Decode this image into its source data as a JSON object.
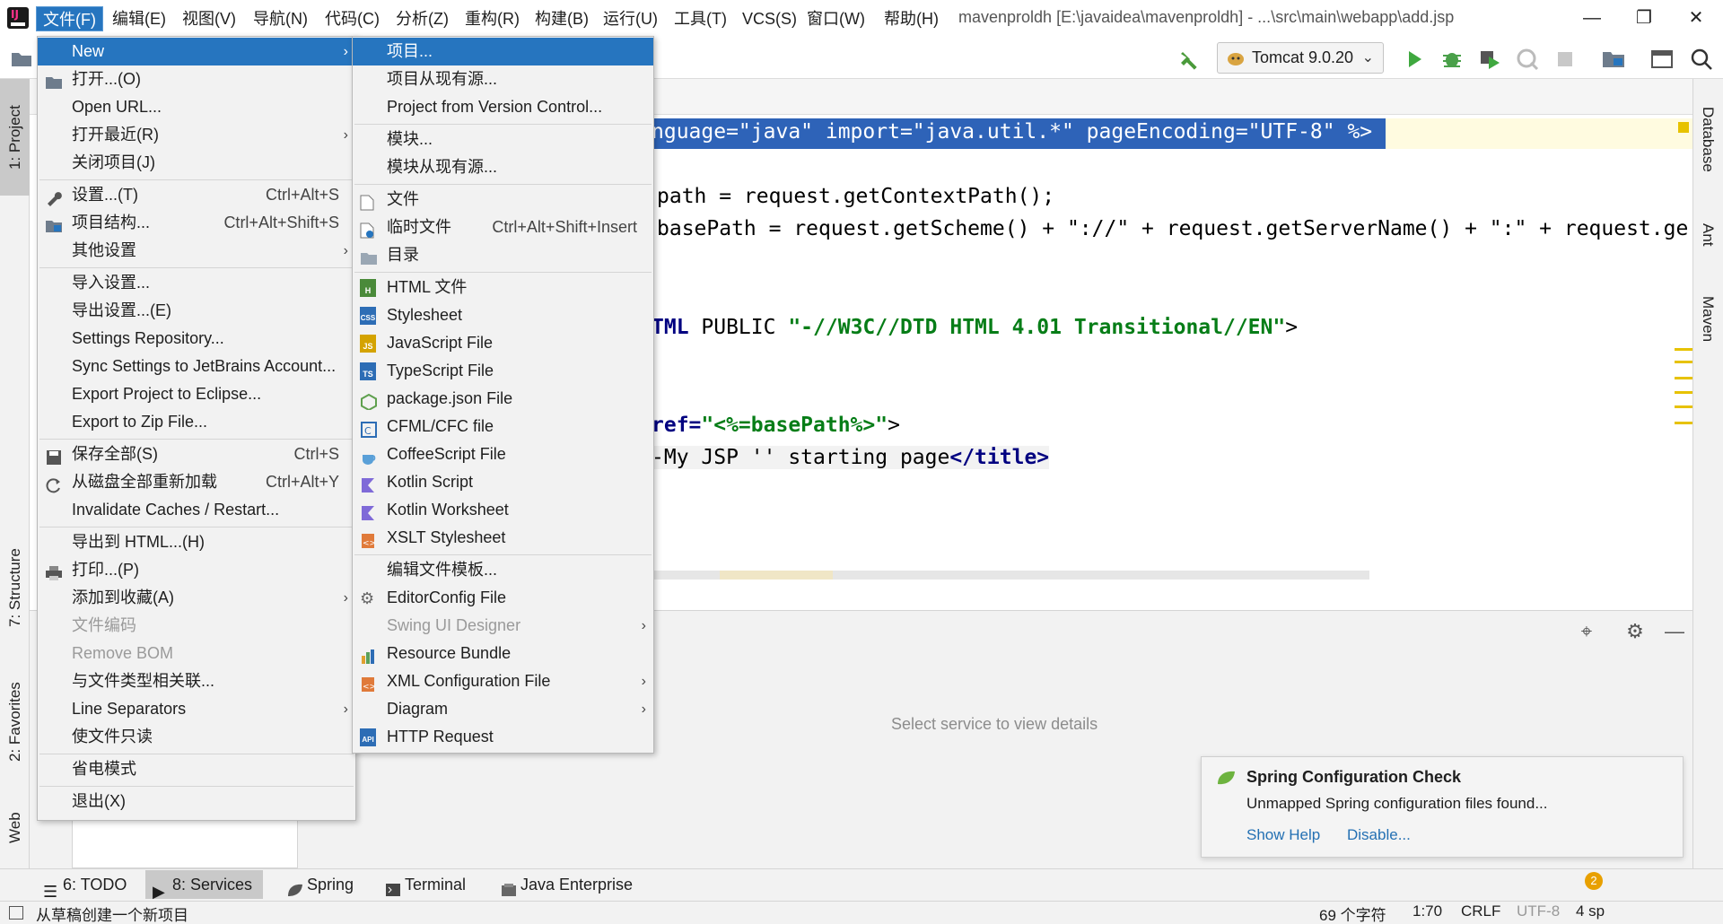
{
  "menubar": {
    "items": [
      "文件(F)",
      "编辑(E)",
      "视图(V)",
      "导航(N)",
      "代码(C)",
      "分析(Z)",
      "重构(R)",
      "构建(B)",
      "运行(U)",
      "工具(T)",
      "VCS(S)",
      "窗口(W)",
      "帮助(H)"
    ],
    "window_title": "mavenproldh [E:\\javaidea\\mavenproldh] - ...\\src\\main\\webapp\\add.jsp"
  },
  "toolbar": {
    "run_config": "Tomcat 9.0.20"
  },
  "left_tabs": {
    "project": "1: Project",
    "structure": "7: Structure",
    "favorites": "2: Favorites",
    "web": "Web"
  },
  "right_tabs": {
    "database": "Database",
    "ant": "Ant",
    "maven": "Maven"
  },
  "editor": {
    "line1_a": "nguage=\"java\" import=\"java.util.*\" pageEncoding=\"UTF-8\" %>",
    "line2": "path = request.getContextPath();",
    "line3": "basePath = request.getScheme() + \"://\" + request.getServerName() + \":\" + request.ge",
    "line4_kw": "TML",
    "line4_rest": " PUBLIC ",
    "line4_str": "\"-//W3C//DTD HTML 4.01 Transitional//EN\"",
    "line4_end": ">",
    "line5_kw": "ref=",
    "line5_str": "\"<%=basePath%>\"",
    "line5_end": ">",
    "line6_a": "My JSP '' starting page",
    "line6_kw": "</title>",
    "line6_prefix": "-"
  },
  "file_menu": {
    "items": [
      {
        "label": "New",
        "shortcut": "",
        "submenu": true
      },
      {
        "label": "打开...(O)",
        "shortcut": ""
      },
      {
        "label": "Open URL...",
        "shortcut": ""
      },
      {
        "label": "打开最近(R)",
        "shortcut": "",
        "submenu": true
      },
      {
        "label": "关闭项目(J)",
        "shortcut": ""
      },
      {
        "label": "设置...(T)",
        "shortcut": "Ctrl+Alt+S"
      },
      {
        "label": "项目结构...",
        "shortcut": "Ctrl+Alt+Shift+S"
      },
      {
        "label": "其他设置",
        "shortcut": "",
        "submenu": true
      },
      {
        "label": "导入设置...",
        "shortcut": ""
      },
      {
        "label": "导出设置...(E)",
        "shortcut": ""
      },
      {
        "label": "Settings Repository...",
        "shortcut": ""
      },
      {
        "label": "Sync Settings to JetBrains Account...",
        "shortcut": ""
      },
      {
        "label": "Export Project to Eclipse...",
        "shortcut": ""
      },
      {
        "label": "Export to Zip File...",
        "shortcut": ""
      },
      {
        "label": "保存全部(S)",
        "shortcut": "Ctrl+S"
      },
      {
        "label": "从磁盘全部重新加载",
        "shortcut": "Ctrl+Alt+Y"
      },
      {
        "label": "Invalidate Caches / Restart...",
        "shortcut": ""
      },
      {
        "label": "导出到 HTML...(H)",
        "shortcut": ""
      },
      {
        "label": "打印...(P)",
        "shortcut": ""
      },
      {
        "label": "添加到收藏(A)",
        "shortcut": "",
        "submenu": true
      },
      {
        "label": "文件编码",
        "shortcut": "",
        "disabled": true
      },
      {
        "label": "Remove BOM",
        "shortcut": "",
        "disabled": true
      },
      {
        "label": "与文件类型相关联...",
        "shortcut": ""
      },
      {
        "label": "Line Separators",
        "shortcut": "",
        "submenu": true
      },
      {
        "label": "使文件只读",
        "shortcut": ""
      },
      {
        "label": "省电模式",
        "shortcut": ""
      },
      {
        "label": "退出(X)",
        "shortcut": ""
      }
    ]
  },
  "new_submenu": {
    "items": [
      {
        "label": "项目...",
        "shortcut": ""
      },
      {
        "label": "项目从现有源...",
        "shortcut": ""
      },
      {
        "label": "Project from Version Control...",
        "shortcut": ""
      },
      {
        "label": "模块...",
        "shortcut": ""
      },
      {
        "label": "模块从现有源...",
        "shortcut": ""
      },
      {
        "label": "文件",
        "shortcut": ""
      },
      {
        "label": "临时文件",
        "shortcut": "Ctrl+Alt+Shift+Insert"
      },
      {
        "label": "目录",
        "shortcut": ""
      },
      {
        "label": "HTML 文件",
        "shortcut": ""
      },
      {
        "label": "Stylesheet",
        "shortcut": ""
      },
      {
        "label": "JavaScript File",
        "shortcut": ""
      },
      {
        "label": "TypeScript File",
        "shortcut": ""
      },
      {
        "label": "package.json File",
        "shortcut": ""
      },
      {
        "label": "CFML/CFC file",
        "shortcut": ""
      },
      {
        "label": "CoffeeScript File",
        "shortcut": ""
      },
      {
        "label": "Kotlin Script",
        "shortcut": ""
      },
      {
        "label": "Kotlin Worksheet",
        "shortcut": ""
      },
      {
        "label": "XSLT Stylesheet",
        "shortcut": ""
      },
      {
        "label": "编辑文件模板...",
        "shortcut": ""
      },
      {
        "label": "EditorConfig File",
        "shortcut": ""
      },
      {
        "label": "Swing UI Designer",
        "shortcut": "",
        "disabled": true,
        "submenu": true
      },
      {
        "label": "Resource Bundle",
        "shortcut": ""
      },
      {
        "label": "XML Configuration File",
        "shortcut": "",
        "submenu": true
      },
      {
        "label": "Diagram",
        "shortcut": "",
        "submenu": true
      },
      {
        "label": "HTTP Request",
        "shortcut": ""
      }
    ],
    "icon_badges": {
      "html": "H",
      "css": "CSS",
      "js": "JS",
      "ts": "TS",
      "api": "API"
    }
  },
  "services": {
    "hint": "Select service to view details"
  },
  "notification": {
    "title": "Spring Configuration Check",
    "body": "Unmapped Spring configuration files found...",
    "show_help": "Show Help",
    "disable": "Disable...",
    "badge_count": "2"
  },
  "bottom_tabs": {
    "todo": "6: TODO",
    "services": "8: Services",
    "spring": "Spring",
    "terminal": "Terminal",
    "java_enterprise": "Java Enterprise"
  },
  "status": {
    "text": "从草稿创建一个新项目",
    "chars": "69 个字符",
    "position": "1:70",
    "line_sep": "CRLF",
    "encoding": "UTF-8",
    "indent": "4 sp"
  },
  "colors": {
    "selection": "#2675bf",
    "keyword": "#000080",
    "string": "#067d17",
    "link": "#2470b3"
  }
}
